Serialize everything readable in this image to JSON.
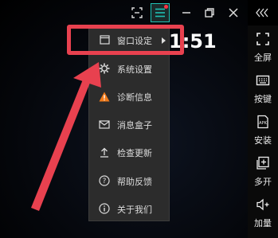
{
  "clock": {
    "time": "1:51"
  },
  "menu": {
    "items": [
      {
        "label": "窗口设定",
        "icon": "window-icon"
      },
      {
        "label": "系统设置",
        "icon": "gear-icon"
      },
      {
        "label": "诊断信息",
        "icon": "warning-icon"
      },
      {
        "label": "消息盒子",
        "icon": "mail-icon"
      },
      {
        "label": "检查更新",
        "icon": "upload-icon"
      },
      {
        "label": "帮助反馈",
        "icon": "help-icon"
      },
      {
        "label": "关于我们",
        "icon": "info-icon"
      }
    ]
  },
  "sidebar": {
    "items": [
      {
        "label": "全屏",
        "icon": "fullscreen-icon"
      },
      {
        "label": "按键",
        "icon": "keyboard-icon"
      },
      {
        "label": "安装",
        "icon": "apk-icon"
      },
      {
        "label": "多开",
        "icon": "multi-open-icon"
      },
      {
        "label": "加量",
        "icon": "volume-up-icon"
      }
    ]
  },
  "colors": {
    "highlight": "#e8414f",
    "accent": "#1fc1b4",
    "notification": "#ff3344"
  }
}
